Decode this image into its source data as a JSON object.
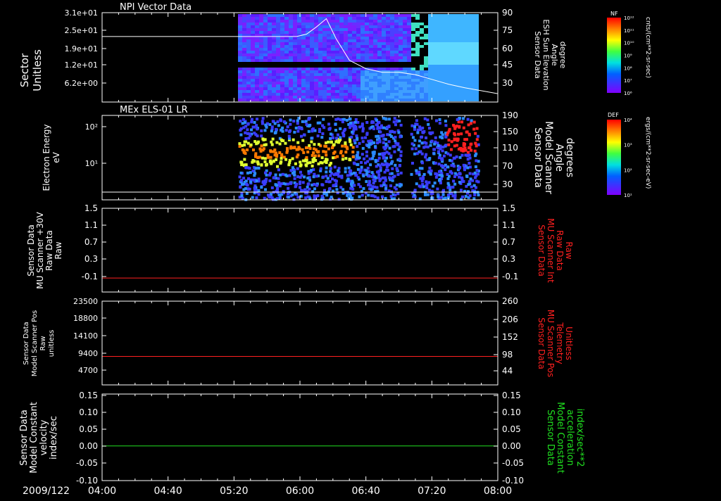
{
  "colors": {
    "background": "#000000",
    "axis": "#ffffff",
    "red": "#ff2020",
    "green": "#20e020"
  },
  "date_label": "2009/122",
  "time_ticks": [
    "04:00",
    "04:40",
    "05:20",
    "06:00",
    "06:40",
    "07:20",
    "08:00"
  ],
  "chart_data": [
    {
      "type": "heatmap",
      "title": "NPI Vector Data",
      "ylabel": [
        "Sector",
        "Unitless"
      ],
      "ytick_labels": [
        "3.1e+01",
        "2.5e+01",
        "1.9e+01",
        "1.2e+01",
        "6.2e+00"
      ],
      "right_ylabel": [
        "Sensor Data",
        "ESH Sun Elevation",
        "Angle",
        "degree"
      ],
      "right_ytick_labels": [
        "90",
        "75",
        "60",
        "45",
        "30"
      ],
      "overlay_line": {
        "x_minutes": [
          0,
          80,
          106,
          118,
          124,
          130,
          136,
          142,
          150,
          160,
          170,
          180,
          190,
          200,
          210,
          220,
          240
        ],
        "y_degrees": [
          70,
          70,
          70,
          70,
          72,
          78,
          85,
          68,
          50,
          43,
          40,
          40,
          38,
          34,
          30,
          27,
          22
        ]
      },
      "colorbar": {
        "label": "NF",
        "units": "cnts/(cm**2-sr-sec)",
        "ticks": [
          "10¹²",
          "10¹¹",
          "10¹⁰",
          "10⁹",
          "10⁸",
          "10⁷",
          "10⁶"
        ]
      }
    },
    {
      "type": "heatmap",
      "title": "MEx ELS-01 LR",
      "ylabel": [
        "Electron Energy",
        "eV"
      ],
      "ytick_labels": [
        "10²",
        "10¹"
      ],
      "right_ylabel": [
        "Sensor Data",
        "Model Scanner",
        "Angle",
        "degrees"
      ],
      "right_ytick_labels": [
        "190",
        "150",
        "110",
        "70",
        "30"
      ],
      "colorbar": {
        "label": "DEF",
        "units": "ergs/(cm**2-sr-sec-eV)",
        "ticks": [
          "10⁴",
          "10³",
          "10²",
          "10¹"
        ]
      }
    },
    {
      "type": "line",
      "ylabel": [
        "Sensor Data",
        "MU Scanner +30V",
        "Raw Data",
        "Raw"
      ],
      "ytick_labels": [
        "1.5",
        "1.1",
        "0.7",
        "0.3",
        "-0.1"
      ],
      "right_ylabel": [
        "Sensor Data",
        "MU Scanner Int",
        "Raw Data",
        "Raw"
      ],
      "right_ytick_labels": [
        "1.5",
        "1.1",
        "0.7",
        "0.3",
        "-0.1"
      ],
      "ylim": [
        -0.3,
        1.5
      ],
      "series": [
        {
          "values_constant": 0
        }
      ]
    },
    {
      "type": "line",
      "ylabel": [
        "Sensor Data",
        "Model Scanner Pos",
        "Raw",
        "unitless"
      ],
      "ytick_labels": [
        "23500",
        "18800",
        "14100",
        "9400",
        "4700"
      ],
      "right_ylabel": [
        "Sensor Data",
        "MU Scanner Pos",
        "Telemetry",
        "Unitless"
      ],
      "right_ytick_labels": [
        "260",
        "206",
        "152",
        "98",
        "44"
      ],
      "ylim": [
        0,
        23500
      ],
      "series": [
        {
          "values_constant": 8000
        }
      ]
    },
    {
      "type": "line",
      "ylabel": [
        "Sensor Data",
        "Model Constant",
        "velocity",
        "index/sec"
      ],
      "ytick_labels": [
        "0.15",
        "0.10",
        "0.05",
        "0.00",
        "-0.05",
        "-0.10"
      ],
      "right_ylabel": [
        "Sensor Data",
        "Model Constant",
        "acceleration",
        "index/sec**2"
      ],
      "right_ytick_labels": [
        "0.15",
        "0.10",
        "0.05",
        "0.00",
        "-0.05",
        "-0.10"
      ],
      "ylim": [
        -0.1,
        0.15
      ],
      "series": [
        {
          "values_constant": 0.0
        }
      ]
    }
  ]
}
